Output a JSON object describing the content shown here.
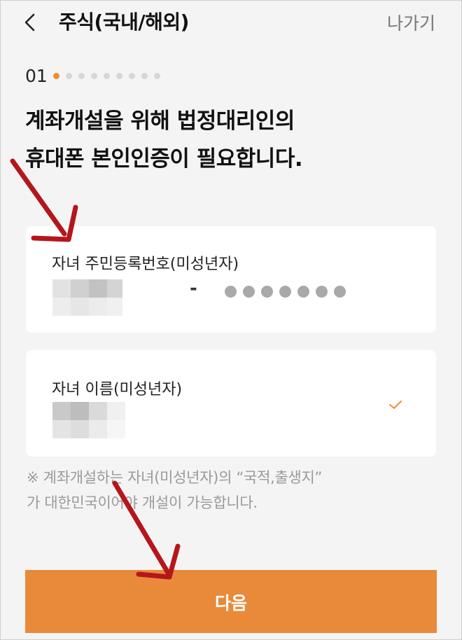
{
  "header": {
    "title": "주식(국내/해외)",
    "exit_label": "나가기"
  },
  "step": {
    "number": "01",
    "current": 1,
    "total": 9
  },
  "heading": {
    "line1": "계좌개설을 위해 법정대리인의",
    "line2": "휴대폰 본인인증이 필요합니다."
  },
  "ssn_card": {
    "label": "자녀 주민등록번호(미성년자)",
    "separator": "-",
    "masked_digit_count": 7
  },
  "name_card": {
    "label": "자녀 이름(미성년자)"
  },
  "notice": {
    "line1": "※ 계좌개설하는 자녀(미성년자)의 “국적,출생지”",
    "line2": "가 대한민국이어야 개설이 가능합니다."
  },
  "next_button": {
    "label": "다음"
  },
  "colors": {
    "accent": "#e88a3a",
    "step_active": "#ef8d32",
    "annotation_arrow": "#b5161b"
  }
}
